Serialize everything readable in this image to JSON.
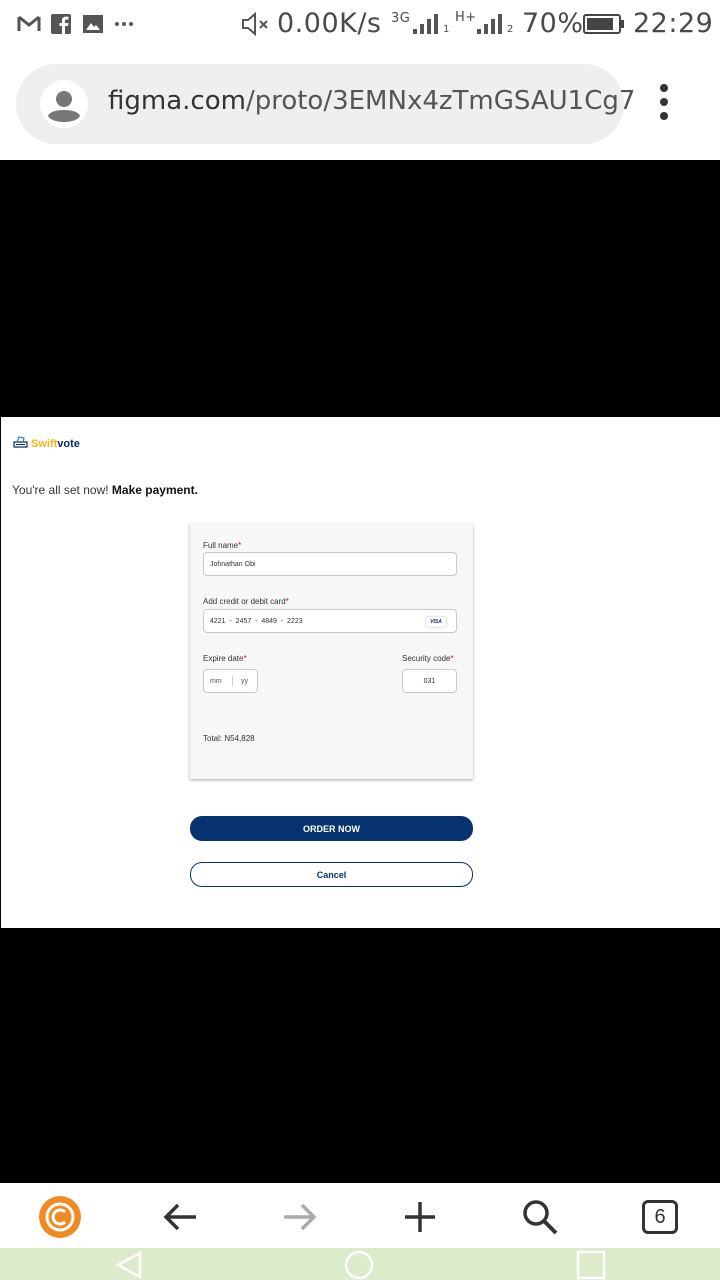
{
  "status_bar": {
    "data_speed": "0.00K/s",
    "network_1": "3G",
    "network_2": "H+",
    "sim_1": "1",
    "sim_2": "2",
    "battery": "70%",
    "time": "22:29",
    "icons": [
      "gmail-icon",
      "facebook-icon",
      "gallery-icon",
      "more-icon",
      "mute-icon",
      "signal-icon",
      "battery-icon"
    ]
  },
  "browser": {
    "url_domain": "figma.com",
    "url_path": "/proto/3EMNx4zTmGSAU1Cg7",
    "tab_count": "6",
    "accent_color": "#f08a24"
  },
  "app": {
    "brand_prefix": "Swift",
    "brand_suffix": "vote",
    "intro_text": "You're all set now!",
    "intro_bold": "Make payment.",
    "form": {
      "full_name_label": "Full name",
      "full_name_value": "Johnathan Obi",
      "card_label": "Add credit or debit card",
      "card_value": "4221  -  2457  -  4849  -  2223",
      "card_brand": "VISA",
      "expire_label": "Expire date",
      "expire_month_placeholder": "mm",
      "expire_year_placeholder": "yy",
      "security_label": "Security code",
      "security_value": "031",
      "required_mark": "*",
      "total": "Total: N54,828"
    },
    "order_button": "ORDER NOW",
    "cancel_button": "Cancel",
    "primary_color": "#06336f"
  }
}
